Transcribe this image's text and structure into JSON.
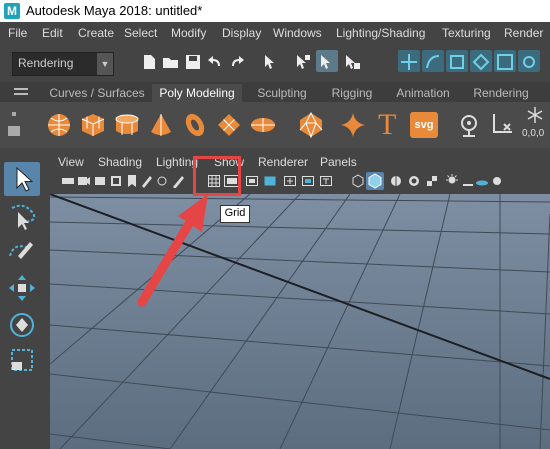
{
  "window": {
    "logo_letter": "M",
    "title": "Autodesk Maya 2018: untitled*"
  },
  "menubar": {
    "items": [
      "File",
      "Edit",
      "Create",
      "Select",
      "Modify",
      "Display",
      "Windows",
      "Lighting/Shading",
      "Texturing",
      "Render"
    ]
  },
  "statusline": {
    "menu_set": "Rendering"
  },
  "shelf": {
    "tabs": [
      "Curves / Surfaces",
      "Poly Modeling",
      "Sculpting",
      "Rigging",
      "Animation",
      "Rendering"
    ],
    "active_tab": "Poly Modeling",
    "icons": [
      "poly-sphere",
      "poly-cube",
      "poly-cylinder",
      "poly-cone",
      "poly-torus",
      "poly-plane",
      "poly-disc",
      "platonic-solid",
      "super-shape",
      "type-text",
      "svg",
      "pivot",
      "measure"
    ],
    "type_text_glyph": "T",
    "svg_label": "svg",
    "zero_readout": "0,0,0"
  },
  "panel": {
    "menus": [
      "View",
      "Shading",
      "Lighting",
      "Show",
      "Renderer",
      "Panels"
    ]
  },
  "tooltip": {
    "text": "Grid"
  },
  "colors": {
    "accent_orange": "#e88a3a",
    "highlight_red": "#e54545",
    "viewport_top": "#7f8fa3",
    "viewport_bottom": "#5d6d80",
    "selected_tool": "#5885a9"
  }
}
